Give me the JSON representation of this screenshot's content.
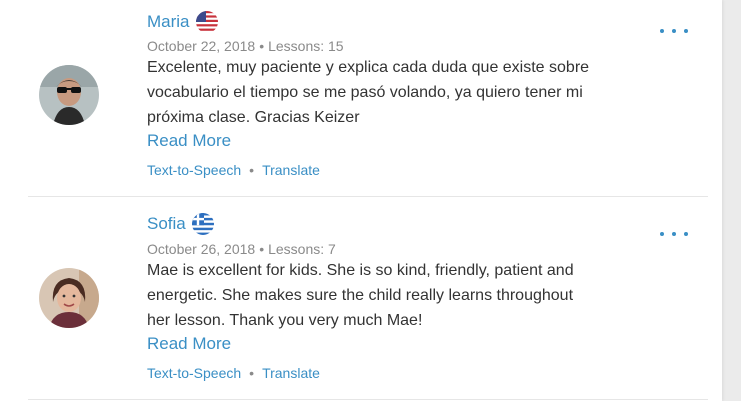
{
  "reviews": [
    {
      "name": "Maria",
      "flag": "us-flag-icon",
      "date": "October 22, 2018",
      "lessons": "Lessons: 15",
      "text": "Excelente, muy paciente y explica cada duda que existe sobre vocabulario el tiempo se me pasó volando, ya quiero tener mi próxima clase. Gracias Keizer",
      "read_more": "Read More",
      "tts": "Text-to-Speech",
      "translate": "Translate"
    },
    {
      "name": "Sofia",
      "flag": "greece-flag-icon",
      "date": "October 26, 2018",
      "lessons": "Lessons: 7",
      "text": "Mae is excellent for kids. She is so kind, friendly, patient and energetic. She makes sure the child really learns throughout her lesson. Thank you very much Mae!",
      "read_more": "Read More",
      "tts": "Text-to-Speech",
      "translate": "Translate"
    }
  ],
  "separator": "•",
  "colors": {
    "link": "#3a8fc5",
    "meta": "#8a8a8a",
    "body": "#333333",
    "background": "#ebebeb"
  }
}
